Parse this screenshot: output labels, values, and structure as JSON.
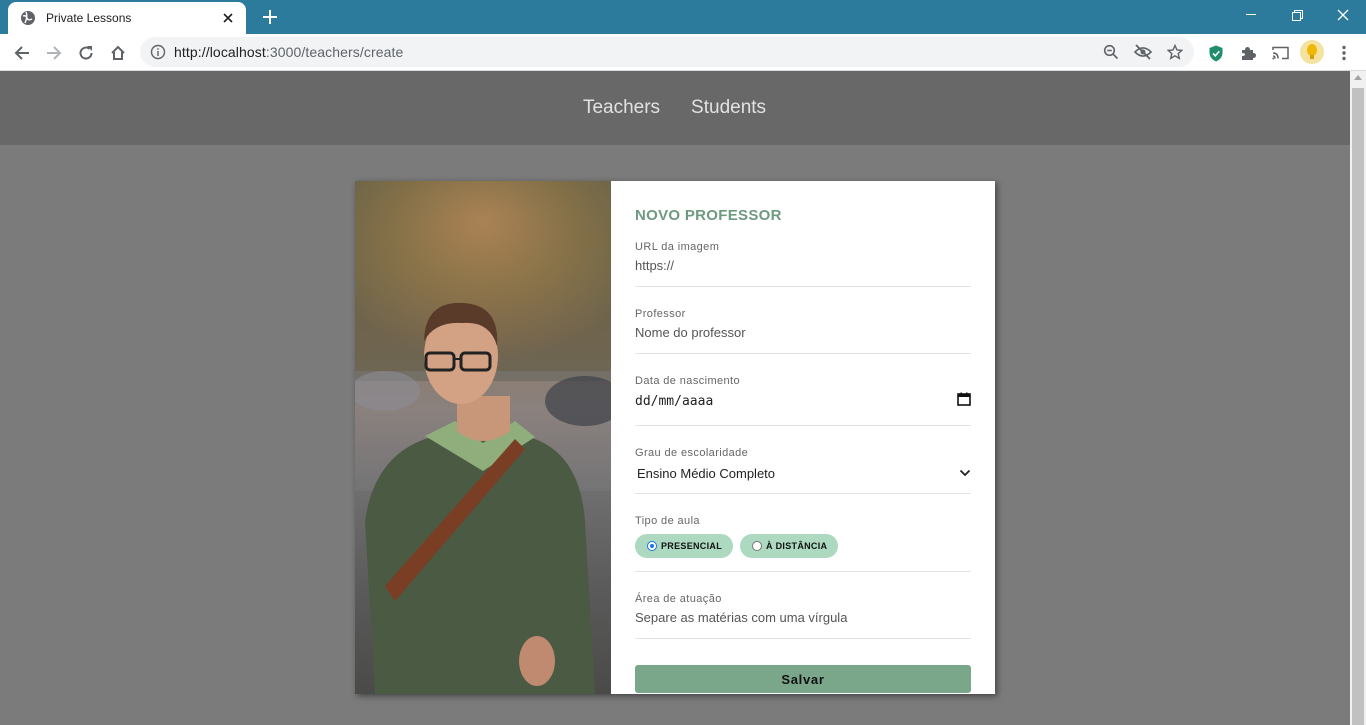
{
  "browser": {
    "tab_title": "Private Lessons",
    "url_host": "http://localhost",
    "url_rest": ":3000/teachers/create"
  },
  "nav": {
    "links": [
      "Teachers",
      "Students"
    ]
  },
  "form": {
    "title": "NOVO PROFESSOR",
    "avatar_url": {
      "label": "URL da imagem",
      "placeholder": "https://"
    },
    "name": {
      "label": "Professor",
      "placeholder": "Nome do professor"
    },
    "birth": {
      "label": "Data de nascimento",
      "placeholder": "dd/mm/aaaa"
    },
    "education": {
      "label": "Grau de escolaridade",
      "selected": "Ensino Médio Completo"
    },
    "class_type": {
      "label": "Tipo de aula",
      "options": [
        {
          "label": "PRESENCIAL",
          "checked": true
        },
        {
          "label": "À DISTÂNCIA",
          "checked": false
        }
      ]
    },
    "subjects": {
      "label": "Área de atuação",
      "placeholder": "Separe as matérias com uma vírgula"
    },
    "submit_label": "Salvar"
  },
  "colors": {
    "tabbar": "#2c7a9c",
    "accent": "#6e9a80",
    "chip": "#acd9c0",
    "button": "#7aa68a"
  },
  "icons": [
    "globe-icon",
    "close-icon",
    "plus-icon",
    "minimize-icon",
    "restore-icon",
    "back-icon",
    "forward-icon",
    "reload-icon",
    "home-icon",
    "info-icon",
    "zoom-icon",
    "eye-off-icon",
    "star-icon",
    "shield-icon",
    "puzzle-icon",
    "cast-icon",
    "menu-dots-icon",
    "calendar-icon",
    "chevron-down-icon"
  ]
}
